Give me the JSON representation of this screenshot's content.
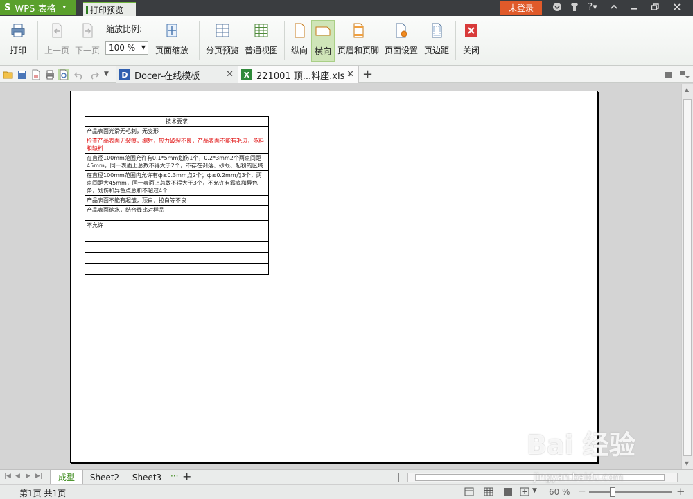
{
  "titlebar": {
    "app_name": "WPS 表格",
    "app_logo": "S",
    "tab_label": "打印预览",
    "login_label": "未登录",
    "help_label": "?"
  },
  "ribbon": {
    "print": "打印",
    "prev_page": "上一页",
    "next_page": "下一页",
    "zoom_label": "缩放比例:",
    "zoom_value": "100 %",
    "page_zoom": "页面缩放",
    "page_break_preview": "分页预览",
    "normal_view": "普通视图",
    "portrait": "纵向",
    "landscape": "横向",
    "header_footer": "页眉和页脚",
    "page_setup": "页面设置",
    "margins": "页边距",
    "close": "关闭"
  },
  "doc_tabs": [
    {
      "label": "Docer-在线模板"
    },
    {
      "label": "221001 顶...料座.xls *"
    }
  ],
  "sheet": {
    "rows": [
      {
        "text": "技术要求",
        "type": "header"
      },
      {
        "text": "产品表面光滑无毛刺，无变形",
        "type": "normal"
      },
      {
        "text": "检查产品表面无裂痕，缩射，应力破裂不良，产品表面不能有毛边，多料和缺料",
        "type": "red"
      },
      {
        "text": "在直径100mm范围允许有0.1*5mm划伤1个，0.2*3mm2个两点间距45mm，同一表面上总数不得大于2个，不存在剥落、砂眼、起粉的区域",
        "type": "normal"
      },
      {
        "text": "在直径100mm范围内允许有ф≤0.3mm点2个；ф≤0.2mm点3个，两点间距大45mm，同一表面上总数不得大于3个，不允许有露底和异色条，划伤和异色点总和不超过4个",
        "type": "normal"
      },
      {
        "text": "产品表面不能有起皱，顶白，拉白等不良",
        "type": "normal"
      },
      {
        "text": "产品表面缩水，结合线比对样品",
        "type": "normal"
      },
      {
        "text": "不允许",
        "type": "normal"
      },
      {
        "text": "",
        "type": "normal"
      },
      {
        "text": "",
        "type": "normal"
      },
      {
        "text": "",
        "type": "normal"
      },
      {
        "text": "",
        "type": "normal"
      }
    ]
  },
  "sheet_tabs": [
    "成型",
    "Sheet2",
    "Sheet3"
  ],
  "sheet_tabs_more": "···",
  "status": {
    "page_info": "第1页 共1页",
    "zoom": "60 %"
  },
  "watermark": {
    "main": "Bai 经验",
    "sub": "jingyan.baidu.com"
  },
  "colors": {
    "app_green": "#5aa02c",
    "login_orange": "#e05a2a",
    "titlebar": "#3a3d40",
    "red_text": "#e01010"
  }
}
